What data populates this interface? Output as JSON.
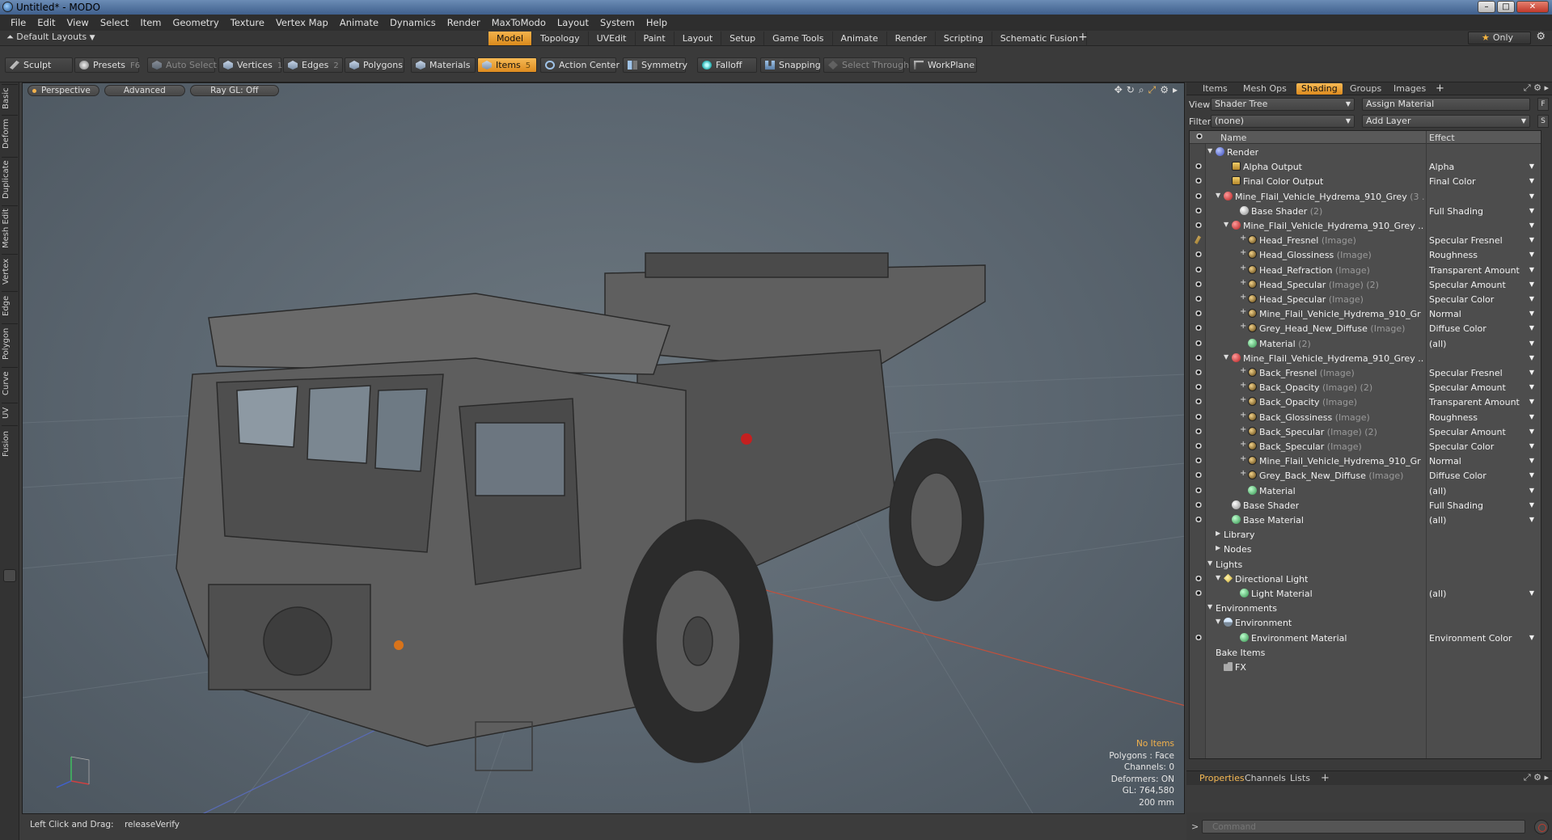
{
  "window": {
    "title": "Untitled* - MODO",
    "minimize": "–",
    "maximize": "□",
    "close": "✕"
  },
  "menu": [
    "File",
    "Edit",
    "View",
    "Select",
    "Item",
    "Geometry",
    "Texture",
    "Vertex Map",
    "Animate",
    "Dynamics",
    "Render",
    "MaxToModo",
    "Layout",
    "System",
    "Help"
  ],
  "layoutbar": {
    "layouts_label": "Default Layouts",
    "tabs": [
      "Model",
      "Topology",
      "UVEdit",
      "Paint",
      "Layout",
      "Setup",
      "Game Tools",
      "Animate",
      "Render",
      "Scripting",
      "Schematic Fusion"
    ],
    "active_tab": "Model",
    "add": "+",
    "only_label": "Only"
  },
  "toolbar": {
    "sculpt": "Sculpt",
    "presets": "Presets",
    "presets_key": "F6",
    "auto_select": "Auto Select",
    "vertices": "Vertices",
    "vertices_key": "1",
    "edges": "Edges",
    "edges_key": "2",
    "polygons": "Polygons",
    "materials": "Materials",
    "items": "Items",
    "items_key": "5",
    "action_center": "Action Center",
    "symmetry": "Symmetry",
    "falloff": "Falloff",
    "snapping": "Snapping",
    "select_through": "Select Through",
    "workplane": "WorkPlane"
  },
  "lefttabs": [
    "Basic",
    "Deform",
    "Duplicate",
    "Mesh Edit",
    "Vertex",
    "Edge",
    "Polygon",
    "Curve",
    "UV",
    "Fusion"
  ],
  "viewport": {
    "view_mode": "Perspective",
    "shading": "Advanced",
    "raygl": "Ray GL: Off",
    "stats": {
      "no_items": "No Items",
      "polygons": "Polygons : Face",
      "channels": "Channels: 0",
      "deformers": "Deformers: ON",
      "gl": "GL: 764,580",
      "scale": "200 mm"
    }
  },
  "status": {
    "hint_key": "Left Click and Drag:",
    "hint_value": "releaseVerify"
  },
  "rightpanel": {
    "tabs": [
      "Items",
      "Mesh Ops",
      "Shading",
      "Groups",
      "Images"
    ],
    "active_tab": "Shading",
    "add": "+",
    "view_label": "View",
    "view_value": "Shader Tree",
    "assign_material": "Assign Material",
    "assign_key": "F",
    "filter_label": "Filter",
    "filter_value": "(none)",
    "add_layer": "Add Layer",
    "add_layer_key": "S",
    "col_name": "Name",
    "col_effect": "Effect",
    "tree": [
      {
        "name": "Render",
        "sub": "",
        "effect": "",
        "depth": 0,
        "icon": "sphere-blue",
        "exp": "▼",
        "eye": false
      },
      {
        "name": "Alpha Output",
        "sub": "",
        "effect": "Alpha",
        "depth": 2,
        "icon": "out",
        "exp": "",
        "eye": true
      },
      {
        "name": "Final Color Output",
        "sub": "",
        "effect": "Final Color",
        "depth": 2,
        "icon": "out",
        "exp": "",
        "eye": true
      },
      {
        "name": "Mine_Flail_Vehicle_Hydrema_910_Grey",
        "sub": " (3 ...",
        "effect": "",
        "depth": 1,
        "icon": "sphere-red",
        "exp": "▼",
        "eye": true
      },
      {
        "name": "Base Shader",
        "sub": " (2)",
        "effect": "Full Shading",
        "depth": 3,
        "icon": "sphere-grey",
        "exp": "",
        "eye": true
      },
      {
        "name": "Mine_Flail_Vehicle_Hydrema_910_Grey ...",
        "sub": "",
        "effect": "",
        "depth": 2,
        "icon": "sphere-red",
        "exp": "▼",
        "eye": true
      },
      {
        "name": "Head_Fresnel",
        "sub": " (Image)",
        "effect": "Specular Fresnel",
        "depth": 4,
        "icon": "tex",
        "exp": "+",
        "eye": "brush"
      },
      {
        "name": "Head_Glossiness",
        "sub": " (Image)",
        "effect": "Roughness",
        "depth": 4,
        "icon": "tex",
        "exp": "+",
        "eye": true
      },
      {
        "name": "Head_Refraction",
        "sub": " (Image)",
        "effect": "Transparent Amount",
        "depth": 4,
        "icon": "tex",
        "exp": "+",
        "eye": true
      },
      {
        "name": "Head_Specular",
        "sub": " (Image) (2)",
        "effect": "Specular Amount",
        "depth": 4,
        "icon": "tex",
        "exp": "+",
        "eye": true
      },
      {
        "name": "Head_Specular",
        "sub": " (Image)",
        "effect": "Specular Color",
        "depth": 4,
        "icon": "tex",
        "exp": "+",
        "eye": true
      },
      {
        "name": "Mine_Flail_Vehicle_Hydrema_910_Gr ...",
        "sub": "",
        "effect": "Normal",
        "depth": 4,
        "icon": "tex",
        "exp": "+",
        "eye": true
      },
      {
        "name": "Grey_Head_New_Diffuse",
        "sub": " (Image)",
        "effect": "Diffuse Color",
        "depth": 4,
        "icon": "tex",
        "exp": "+",
        "eye": true
      },
      {
        "name": "Material",
        "sub": " (2)",
        "effect": "(all)",
        "depth": 4,
        "icon": "sphere-green",
        "exp": "",
        "eye": true
      },
      {
        "name": "Mine_Flail_Vehicle_Hydrema_910_Grey ...",
        "sub": "",
        "effect": "",
        "depth": 2,
        "icon": "sphere-red",
        "exp": "▼",
        "eye": true
      },
      {
        "name": "Back_Fresnel",
        "sub": " (Image)",
        "effect": "Specular Fresnel",
        "depth": 4,
        "icon": "tex",
        "exp": "+",
        "eye": true
      },
      {
        "name": "Back_Opacity",
        "sub": " (Image) (2)",
        "effect": "Specular Amount",
        "depth": 4,
        "icon": "tex",
        "exp": "+",
        "eye": true
      },
      {
        "name": "Back_Opacity",
        "sub": " (Image)",
        "effect": "Transparent Amount",
        "depth": 4,
        "icon": "tex",
        "exp": "+",
        "eye": true
      },
      {
        "name": "Back_Glossiness",
        "sub": " (Image)",
        "effect": "Roughness",
        "depth": 4,
        "icon": "tex",
        "exp": "+",
        "eye": true
      },
      {
        "name": "Back_Specular",
        "sub": " (Image) (2)",
        "effect": "Specular Amount",
        "depth": 4,
        "icon": "tex",
        "exp": "+",
        "eye": true
      },
      {
        "name": "Back_Specular",
        "sub": " (Image)",
        "effect": "Specular Color",
        "depth": 4,
        "icon": "tex",
        "exp": "+",
        "eye": true
      },
      {
        "name": "Mine_Flail_Vehicle_Hydrema_910_Gr ...",
        "sub": "",
        "effect": "Normal",
        "depth": 4,
        "icon": "tex",
        "exp": "+",
        "eye": true
      },
      {
        "name": "Grey_Back_New_Diffuse",
        "sub": " (Image)",
        "effect": "Diffuse Color",
        "depth": 4,
        "icon": "tex",
        "exp": "+",
        "eye": true
      },
      {
        "name": "Material",
        "sub": "",
        "effect": "(all)",
        "depth": 4,
        "icon": "sphere-green",
        "exp": "",
        "eye": true
      },
      {
        "name": "Base Shader",
        "sub": "",
        "effect": "Full Shading",
        "depth": 2,
        "icon": "sphere-grey",
        "exp": "",
        "eye": true
      },
      {
        "name": "Base Material",
        "sub": "",
        "effect": "(all)",
        "depth": 2,
        "icon": "sphere-green",
        "exp": "",
        "eye": true
      },
      {
        "name": "Library",
        "sub": "",
        "effect": "",
        "depth": 1,
        "icon": "",
        "exp": "▶",
        "eye": false
      },
      {
        "name": "Nodes",
        "sub": "",
        "effect": "",
        "depth": 1,
        "icon": "",
        "exp": "▶",
        "eye": false
      },
      {
        "name": "Lights",
        "sub": "",
        "effect": "",
        "depth": 0,
        "icon": "",
        "exp": "▼",
        "eye": false
      },
      {
        "name": "Directional Light",
        "sub": "",
        "effect": "",
        "depth": 1,
        "icon": "light",
        "exp": "▼",
        "eye": true
      },
      {
        "name": "Light Material",
        "sub": "",
        "effect": "(all)",
        "depth": 3,
        "icon": "sphere-green",
        "exp": "",
        "eye": true
      },
      {
        "name": "Environments",
        "sub": "",
        "effect": "",
        "depth": 0,
        "icon": "",
        "exp": "▼",
        "eye": false
      },
      {
        "name": "Environment",
        "sub": "",
        "effect": "",
        "depth": 1,
        "icon": "env",
        "exp": "▼",
        "eye": false
      },
      {
        "name": "Environment Material",
        "sub": "",
        "effect": "Environment Color",
        "depth": 3,
        "icon": "sphere-green",
        "exp": "",
        "eye": true
      },
      {
        "name": "Bake Items",
        "sub": "",
        "effect": "",
        "depth": 0,
        "icon": "",
        "exp": "",
        "eye": false
      },
      {
        "name": "FX",
        "sub": "",
        "effect": "",
        "depth": 1,
        "icon": "folder",
        "exp": "",
        "eye": false
      }
    ],
    "props_tabs": [
      "Properties",
      "Channels",
      "Lists"
    ],
    "props_active": "Properties",
    "props_add": "+"
  },
  "command": {
    "placeholder": "Command",
    "prompt": ">"
  },
  "colors": {
    "accent": "#f3b24c",
    "viewport_bg": "#5b6670"
  }
}
